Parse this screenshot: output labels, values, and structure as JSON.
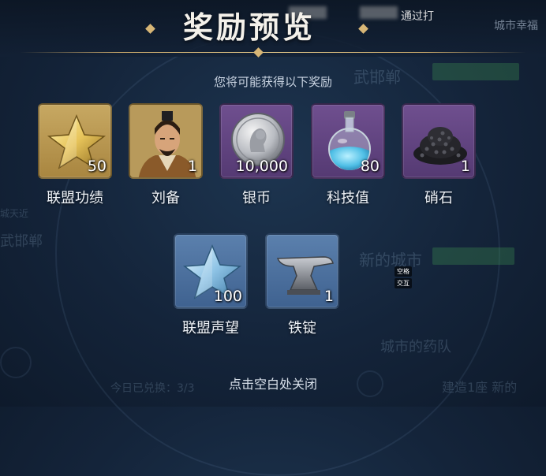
{
  "header": {
    "title": "奖励预览",
    "notice_fragment": "通过打"
  },
  "subtitle": "您将可能获得以下奖励",
  "rewards": [
    {
      "name": "联盟功绩",
      "qty": "50",
      "icon": "gold-star-icon",
      "frame": "gold"
    },
    {
      "name": "刘备",
      "qty": "1",
      "icon": "liu-bei-portrait",
      "frame": "gold"
    },
    {
      "name": "银币",
      "qty": "10,000",
      "icon": "silver-coin-icon",
      "frame": "purple"
    },
    {
      "name": "科技值",
      "qty": "80",
      "icon": "potion-flask-icon",
      "frame": "purple"
    },
    {
      "name": "硝石",
      "qty": "1",
      "icon": "saltpeter-pile-icon",
      "frame": "purple"
    },
    {
      "name": "联盟声望",
      "qty": "100",
      "icon": "blue-star-icon",
      "frame": "blue"
    },
    {
      "name": "铁锭",
      "qty": "1",
      "icon": "anvil-icon",
      "frame": "blue"
    }
  ],
  "footer": "点击空白处关闭",
  "tooltip": {
    "line1": "空格",
    "line2": "交互"
  },
  "background": {
    "top_right": "城市幸福",
    "left_city": "武邯郸",
    "left_city2": "武邯郸",
    "left_small": "城天近",
    "right_new_city": "新的城市",
    "right_lower": "城市的药队",
    "bottom_left": "今日已兑换：3/3",
    "bottom_right": "建造1座 新的"
  },
  "colors": {
    "gold_frame": "#b8954f",
    "purple_frame": "#62457f",
    "blue_frame": "#4d71a0",
    "accent_line": "#c9a86a"
  }
}
